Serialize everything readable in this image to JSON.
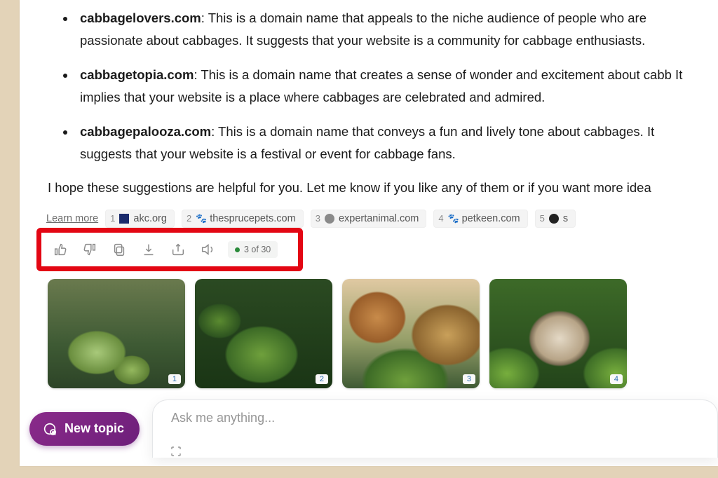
{
  "response": {
    "items": [
      {
        "domain": "cabbagelovers.com",
        "desc": ": This is a domain name that appeals to the niche audience of people who are passionate about cabbages. It suggests that your website is a community for cabbage enthusiasts."
      },
      {
        "domain": "cabbagetopia.com",
        "desc": ": This is a domain name that creates a sense of wonder and excitement about cabb It implies that your website is a place where cabbages are celebrated and admired."
      },
      {
        "domain": "cabbagepalooza.com",
        "desc": ": This is a domain name that conveys a fun and lively tone about cabbages. It suggests that your website is a festival or event for cabbage fans."
      }
    ],
    "closing": "I hope these suggestions are helpful for you. Let me know if you like any of them or if you want more idea"
  },
  "learn": {
    "label": "Learn more",
    "cites": [
      {
        "n": "1",
        "site": "akc.org"
      },
      {
        "n": "2",
        "site": "thesprucepets.com"
      },
      {
        "n": "3",
        "site": "expertanimal.com"
      },
      {
        "n": "4",
        "site": "petkeen.com"
      },
      {
        "n": "5",
        "site": "s"
      }
    ]
  },
  "toolbar": {
    "counter": "3 of 30"
  },
  "images": {
    "badges": [
      "1",
      "2",
      "3",
      "4"
    ]
  },
  "composer": {
    "new_topic": "New topic",
    "placeholder": "Ask me anything..."
  }
}
